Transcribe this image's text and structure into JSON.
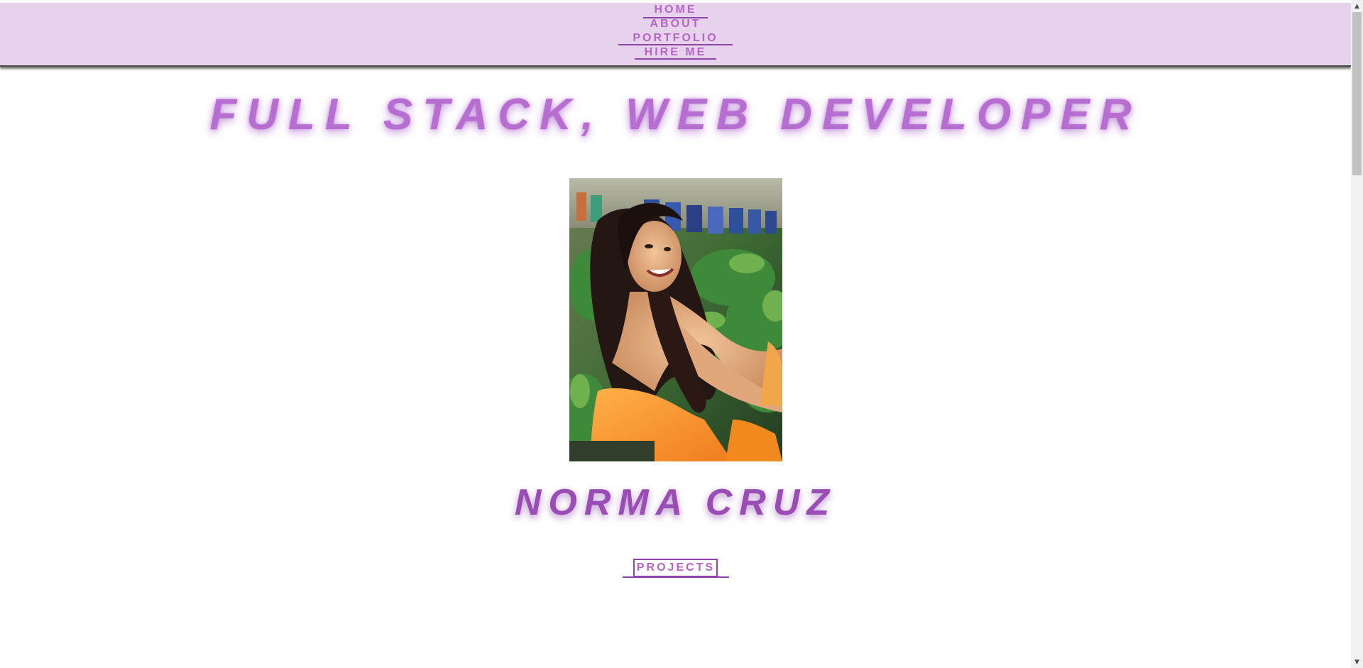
{
  "nav": {
    "items": [
      {
        "label": "HOME"
      },
      {
        "label": "ABOUT"
      },
      {
        "label": "PORTFOLIO"
      },
      {
        "label": "HIRE ME"
      }
    ]
  },
  "hero": {
    "headline": "FULL STACK, WEB DEVELOPER",
    "name": "NORMA CRUZ",
    "projects_button": "PROJECTS"
  },
  "colors": {
    "navbar_bg": "#e7d2ec",
    "accent": "#b465c6",
    "accent_dark": "#8e44a8",
    "background": "#ffffff"
  },
  "icons": {
    "scroll_up": "chevron-up-icon",
    "scroll_down": "chevron-down-icon"
  }
}
